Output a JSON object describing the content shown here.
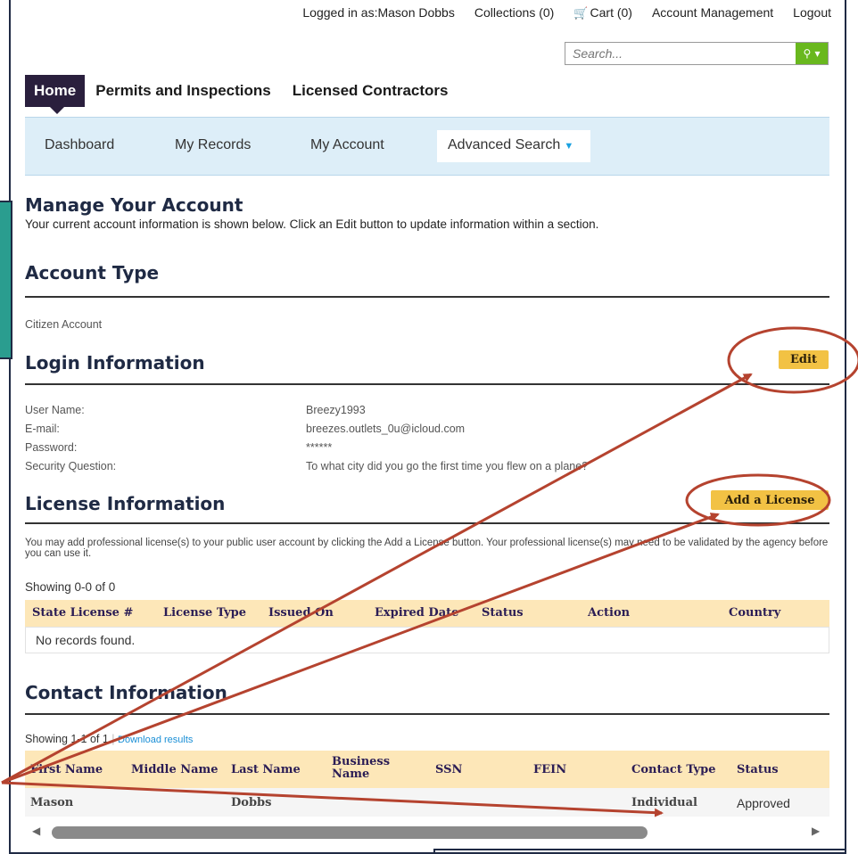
{
  "topbar": {
    "logged_in": "Logged in as:Mason Dobbs",
    "collections": "Collections (0)",
    "cart": "Cart (0)",
    "account_management": "Account Management",
    "logout": "Logout"
  },
  "search": {
    "placeholder": "Search..."
  },
  "main_nav": [
    "Home",
    "Permits and Inspections",
    "Licensed Contractors"
  ],
  "sub_nav": {
    "dashboard": "Dashboard",
    "my_records": "My Records",
    "my_account": "My Account",
    "advanced_search": "Advanced Search"
  },
  "page": {
    "title": "Manage Your Account",
    "intro": "Your current account information is shown below. Click an Edit button to update information within a section."
  },
  "account_type": {
    "title": "Account Type",
    "value": "Citizen Account"
  },
  "login": {
    "title": "Login Information",
    "edit_label": "Edit",
    "fields": [
      {
        "label": "User Name:",
        "value": "Breezy1993"
      },
      {
        "label": "E-mail:",
        "value": "breezes.outlets_0u@icloud.com"
      },
      {
        "label": "Password:",
        "value": "******"
      },
      {
        "label": "Security Question:",
        "value": "To what city did you go the first time you flew on a plane?"
      }
    ]
  },
  "license": {
    "title": "License Information",
    "add_label": "Add a License",
    "description": "You may add professional license(s) to your public user account by clicking the Add a License button. Your professional license(s) may need to be validated by the agency before you can use it.",
    "showing": "Showing 0-0 of 0",
    "columns": [
      "State License #",
      "License Type",
      "Issued On",
      "Expired Date",
      "Status",
      "Action",
      "Country"
    ],
    "empty": "No records found."
  },
  "contact": {
    "title": "Contact Information",
    "showing": "Showing 1-1 of 1",
    "download": "Download results",
    "columns": [
      "First Name",
      "Middle Name",
      "Last Name",
      "Business Name",
      "SSN",
      "FEIN",
      "Contact Type",
      "Status"
    ],
    "row": {
      "first": "Mason",
      "middle": "",
      "last": "Dobbs",
      "business": "",
      "ssn": "",
      "fein": "",
      "type": "Individual",
      "status": "Approved"
    }
  },
  "colors": {
    "accent_gold": "#f2c244",
    "nav_dark": "#2a1f3d",
    "annotation": "#b5432f",
    "subnav_bg": "#ddeef8"
  }
}
